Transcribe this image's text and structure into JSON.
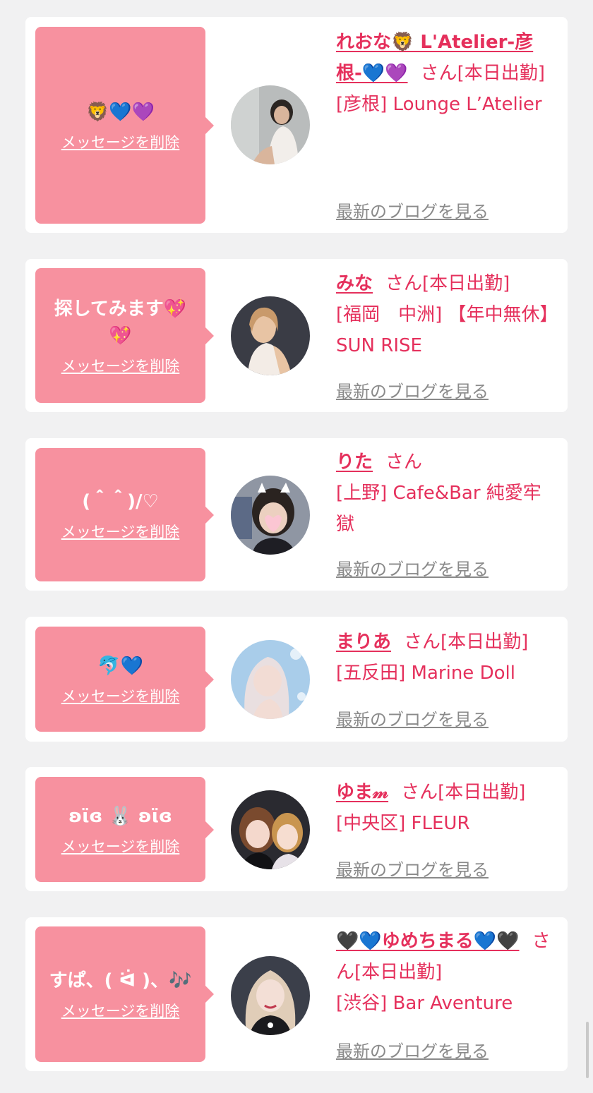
{
  "delete_label": "メッセージを削除",
  "blog_label": "最新のブログを見る",
  "san_label": "さん",
  "cards": [
    {
      "message": "🦁💙💜",
      "name": "れおな🦁 L'Atelier-彦根-💙💜",
      "status": "[本日出勤]",
      "shop": "[彦根] Lounge L’Atelier",
      "avatar": "portrait-photo"
    },
    {
      "message": "探してみます💖💖",
      "name": "みな",
      "status": "[本日出勤]",
      "shop": "[福岡　中洲] 【年中無休】SUN RISE",
      "avatar": "portrait-photo"
    },
    {
      "message": "(＾＾)/♡",
      "name": "りた",
      "status": "",
      "shop": "[上野] Cafe&Bar 純愛牢獄",
      "avatar": "portrait-photo"
    },
    {
      "message": "🐬💙",
      "name": "まりあ",
      "status": "[本日出勤]",
      "shop": "[五反田] Marine Doll",
      "avatar": "portrait-photo"
    },
    {
      "message": "ʚϊɞ 🐰 ʚϊɞ",
      "name": "ゆま𝓂",
      "status": "[本日出勤]",
      "shop": "[中央区] FLEUR",
      "avatar": "portrait-photo"
    },
    {
      "message": "すぱ、( ᐛ )、🎶",
      "name": "🖤💙ゆめちまる💙🖤",
      "status": "[本日出勤]",
      "shop": "[渋谷] Bar Aventure",
      "avatar": "portrait-photo"
    }
  ],
  "colors": {
    "background": "#f1f1f2",
    "bubble": "#f7919f",
    "accent": "#e5305c",
    "link_gray": "#8a8a8a"
  }
}
